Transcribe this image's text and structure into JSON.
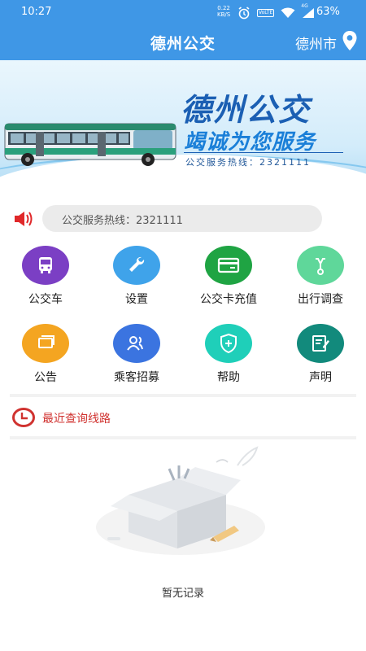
{
  "status_bar": {
    "time": "10:27",
    "speed_value": "0.22",
    "speed_unit": "KB/S",
    "volte": "VoLTE",
    "signal": "4G",
    "battery": "63%"
  },
  "header": {
    "title": "德州公交",
    "city": "德州市"
  },
  "banner": {
    "title": "德州公交",
    "slogan": "竭诚为您服务",
    "hotline": "公交服务热线：2321111"
  },
  "notice": {
    "text": "公交服务热线：2321111"
  },
  "menu": [
    {
      "label": "公交车",
      "icon": "bus-icon",
      "color": "#7b3fc4"
    },
    {
      "label": "设置",
      "icon": "wrench-icon",
      "color": "#3fa3ea"
    },
    {
      "label": "公交卡充值",
      "icon": "card-icon",
      "color": "#1fa443"
    },
    {
      "label": "出行调查",
      "icon": "bike-icon",
      "color": "#5fd79a"
    },
    {
      "label": "公告",
      "icon": "announcement-icon",
      "color": "#f4a521"
    },
    {
      "label": "乘客招募",
      "icon": "people-icon",
      "color": "#3b74e0"
    },
    {
      "label": "帮助",
      "icon": "shield-plus-icon",
      "color": "#1fcfb9"
    },
    {
      "label": "声明",
      "icon": "document-pen-icon",
      "color": "#128a7c"
    }
  ],
  "recent": {
    "label": "最近查询线路",
    "empty_text": "暂无记录"
  },
  "colors": {
    "primary": "#3f97e6",
    "accent_red": "#d0322f"
  }
}
